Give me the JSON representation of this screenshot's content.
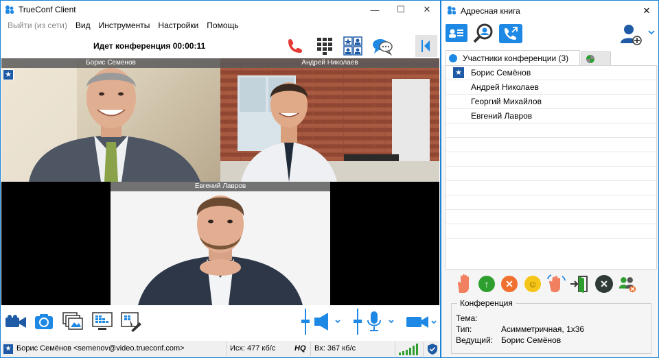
{
  "main_window": {
    "title": "TrueConf Client",
    "controls": {
      "minimize": "—",
      "maximize": "☐",
      "close": "✕"
    },
    "menu": [
      {
        "label": "Выйти (из сети)",
        "disabled": true
      },
      {
        "label": "Вид",
        "disabled": false
      },
      {
        "label": "Инструменты",
        "disabled": false
      },
      {
        "label": "Настройки",
        "disabled": false
      },
      {
        "label": "Помощь",
        "disabled": false
      }
    ],
    "conference_status": "Идет конференция 00:00:11",
    "toolbar_icons": [
      "hangup-icon",
      "dialpad-icon",
      "layout-icon",
      "chat-icon",
      "collapse-panel-icon"
    ],
    "videos": [
      {
        "name": "Борис Семенов",
        "is_owner": true
      },
      {
        "name": "Андрей Николаев",
        "is_owner": false
      },
      {
        "name": "Евгений Лавров",
        "is_owner": false
      }
    ],
    "bottom_icons": [
      "camera-icon",
      "snapshot-icon",
      "slideshow-icon",
      "screen-share-icon",
      "remote-desktop-icon",
      "speaker-icon",
      "microphone-icon",
      "video-camera-icon"
    ],
    "status": {
      "user": "Борис Семёнов <semenov@video.trueconf.com>",
      "outgoing": "Исх: 477 кб/с",
      "quality": "HQ",
      "incoming": "Вх: 367 кб/с"
    }
  },
  "address_book": {
    "title": "Адресная книга",
    "close": "✕",
    "tab_active": "Участники конференции (3)",
    "participants": [
      {
        "name": "Борис Семёнов",
        "owner": true
      },
      {
        "name": "Андрей Николаев",
        "owner": false
      },
      {
        "name": "Георгий Михайлов",
        "owner": false
      },
      {
        "name": "Евгений Лавров",
        "owner": false
      }
    ],
    "conference": {
      "legend": "Конференция",
      "topic_label": "Тема:",
      "topic_value": "",
      "type_label": "Тип:",
      "type_value": "Асимметричная, 1x36",
      "host_label": "Ведущий:",
      "host_value": "Борис Семёнов"
    }
  },
  "colors": {
    "accent": "#1883d7",
    "owner_star": "#1f5aa6",
    "hangup": "#e53935",
    "signal": "#2e9e2e"
  }
}
